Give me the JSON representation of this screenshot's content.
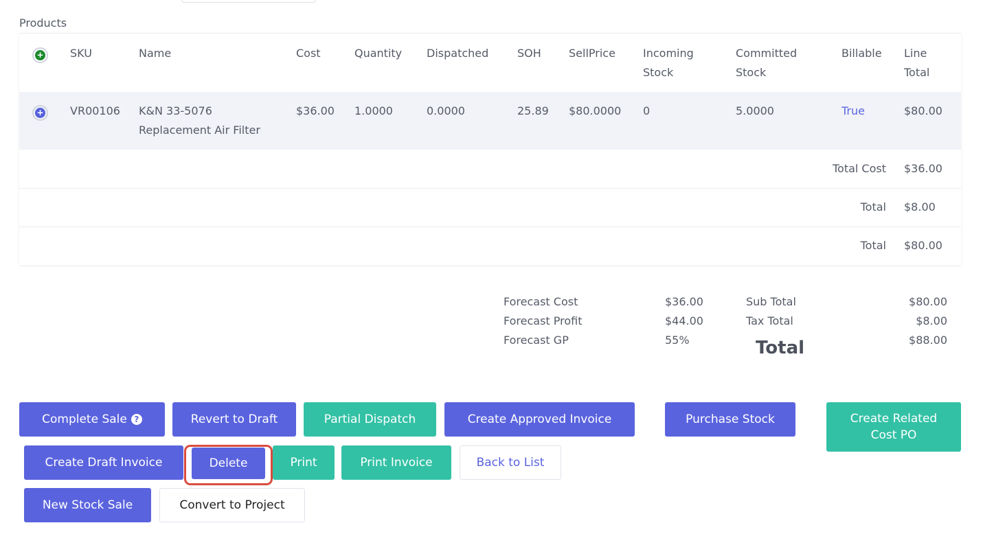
{
  "section_title": "Products",
  "table": {
    "headers": {
      "sku": "SKU",
      "name": "Name",
      "cost": "Cost",
      "quantity": "Quantity",
      "dispatched": "Dispatched",
      "soh": "SOH",
      "sellprice": "SellPrice",
      "incoming_1": "Incoming",
      "incoming_2": "Stock",
      "committed_1": "Committed",
      "committed_2": "Stock",
      "billable": "Billable",
      "line_total_1": "Line",
      "line_total_2": "Total"
    },
    "row": {
      "sku": "VR00106",
      "name_1": "K&N 33-5076",
      "name_2": "Replacement Air Filter",
      "cost": "$36.00",
      "quantity": "1.0000",
      "dispatched": "0.0000",
      "soh": "25.89",
      "sellprice": "$80.0000",
      "incoming": "0",
      "committed": "5.0000",
      "billable": "True",
      "line_total": "$80.00"
    },
    "totals": [
      {
        "label": "Total Cost",
        "value": "$36.00"
      },
      {
        "label": "Total",
        "value": "$8.00"
      },
      {
        "label": "Total",
        "value": "$80.00"
      }
    ]
  },
  "forecast": {
    "cost_label": "Forecast Cost",
    "cost_value": "$36.00",
    "profit_label": "Forecast Profit",
    "profit_value": "$44.00",
    "gp_label": "Forecast GP",
    "gp_value": "55%"
  },
  "summary": {
    "subtotal_label": "Sub Total",
    "subtotal_value": "$80.00",
    "tax_label": "Tax Total",
    "tax_value": "$8.00",
    "total_value": "$88.00",
    "total_label": "Total"
  },
  "buttons": {
    "complete_sale": "Complete Sale",
    "revert_to_draft": "Revert to Draft",
    "partial_dispatch": "Partial Dispatch",
    "create_approved_invoice": "Create Approved Invoice",
    "purchase_stock": "Purchase Stock",
    "create_related_cost_po_1": "Create Related",
    "create_related_cost_po_2": "Cost PO",
    "create_draft_invoice": "Create Draft Invoice",
    "delete": "Delete",
    "print": "Print",
    "print_invoice": "Print Invoice",
    "back_to_list": "Back to List",
    "new_stock_sale": "New Stock Sale",
    "convert_to_project": "Convert to Project"
  },
  "icons": {
    "add_row": "plus-circle-icon",
    "expand_row": "plus-circle-icon",
    "help": "question-circle-icon"
  },
  "colors": {
    "primary": "#5a63de",
    "teal": "#33c1a5",
    "highlight": "#d94b3e",
    "add_green": "#1b8a2c"
  }
}
